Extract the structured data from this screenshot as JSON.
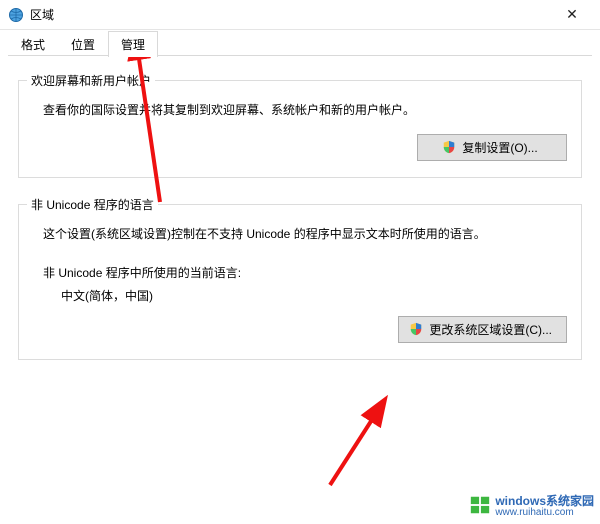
{
  "window": {
    "title": "区域",
    "close_glyph": "✕"
  },
  "tabs": {
    "format": "格式",
    "location": "位置",
    "admin": "管理"
  },
  "group1": {
    "legend": "欢迎屏幕和新用户帐户",
    "desc": "查看你的国际设置并将其复制到欢迎屏幕、系统帐户和新的用户帐户。",
    "button": "复制设置(O)..."
  },
  "group2": {
    "legend": "非 Unicode 程序的语言",
    "desc": "这个设置(系统区域设置)控制在不支持 Unicode 的程序中显示文本时所使用的语言。",
    "sublabel": "非 Unicode 程序中所使用的当前语言:",
    "value": "中文(简体，中国)",
    "button": "更改系统区域设置(C)..."
  },
  "watermark": {
    "main": "windows系统家园",
    "sub": "www.ruihaitu.com"
  }
}
